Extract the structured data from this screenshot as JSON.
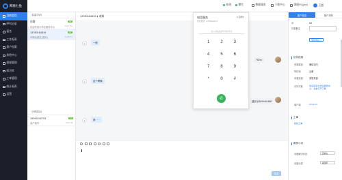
{
  "app": {
    "name": "网易七鱼"
  },
  "topbar": {
    "status1": "在线",
    "status2": "繁忙",
    "item3": "数据服务",
    "item4": "下载中心",
    "user": "王超",
    "agent": "客服RL(jaw)",
    "colors": {
      "online": "#37b35a",
      "busy": "#37b35a",
      "accent": "#2f80ed"
    }
  },
  "sidebar": {
    "items": [
      {
        "label": "当前会话",
        "icon": "chat-icon",
        "active": true
      },
      {
        "label": "呼叫记录",
        "icon": "phone-icon"
      },
      {
        "label": "留言",
        "icon": "message-icon"
      },
      {
        "label": "工作报表",
        "icon": "report-icon"
      },
      {
        "label": "客户档案",
        "icon": "contact-icon"
      },
      {
        "label": "质检中心",
        "icon": "check-icon"
      },
      {
        "label": "客服管理",
        "icon": "admin-icon"
      },
      {
        "label": "知识库",
        "icon": "book-icon"
      },
      {
        "label": "工单管理",
        "icon": "ticket-icon"
      },
      {
        "label": "统计报表",
        "icon": "chart-icon"
      },
      {
        "label": "设置",
        "icon": "gear-icon"
      }
    ]
  },
  "convlist": {
    "current_header": "· 会话中(2)",
    "ended_header": "· 已完成(1)",
    "items": [
      {
        "name": "访客",
        "preview": "欢迎来到大学生服务中心",
        "time": "14:07:34",
        "badge": "VIP"
      },
      {
        "name": "13780164819",
        "preview": "请稍后回复 [图片]",
        "time": "14:08:13",
        "badge": "VIP"
      }
    ],
    "ended": [
      {
        "name": "15094240703",
        "preview": "用户离开",
        "time": "14:07:20",
        "badge": "VIP"
      }
    ]
  },
  "chat": {
    "title": "13780164819 ● 未知",
    "messages": [
      {
        "num": "1",
        "text": "一般",
        "side": "left"
      },
      {
        "num": "1",
        "text": "这个啊懂",
        "side": "left"
      },
      {
        "num": "1",
        "text": "我 · · ·",
        "side": "left"
      }
    ],
    "right_messages": [
      {
        "text": "?52xx",
        "meta": ""
      },
      {
        "text": "[图片]15094461869",
        "meta": ""
      }
    ],
    "send_label": "发送"
  },
  "dialer": {
    "title": "电话服务",
    "subtitle": "未分配线 · 4783/02/09 ▾",
    "status": "● 空闲 ▾",
    "input_placeholder": "输入或粘贴要呼叫的号码",
    "keys": [
      "1",
      "2",
      "3",
      "4",
      "5",
      "6",
      "7",
      "8",
      "9",
      "*",
      "0",
      "#"
    ]
  },
  "rpanel": {
    "tabs": [
      "客户信息",
      "客户资料"
    ],
    "rows": [
      {
        "label": "ID",
        "value": "ket"
      },
      {
        "label": "访客备注",
        "value": ""
      }
    ],
    "save_label": "保存更多(+)",
    "visitor_section": "访问信息",
    "visitor_rows": [
      {
        "label": "来源渠道",
        "value": "微信访问"
      },
      {
        "label": "所在地",
        "value": "云南"
      },
      {
        "label": "来源页面",
        "value": "未知来源"
      },
      {
        "label": "访问次数",
        "value": "欢迎来到大学生服务中心，点击打开了解"
      },
      {
        "label": "客户端",
        "value": "iOS 10.0"
      }
    ],
    "ticket_section": "工单",
    "ticket_link": "新建工单",
    "ticket_tag": "服务记录",
    "summary_section": "服务小记",
    "summary_rows": [
      {
        "label": "问题解决状态",
        "value": "已解决"
      },
      {
        "label": "问题分类",
        "value": "请选择"
      }
    ],
    "tags": [
      "添加",
      "备注"
    ]
  }
}
